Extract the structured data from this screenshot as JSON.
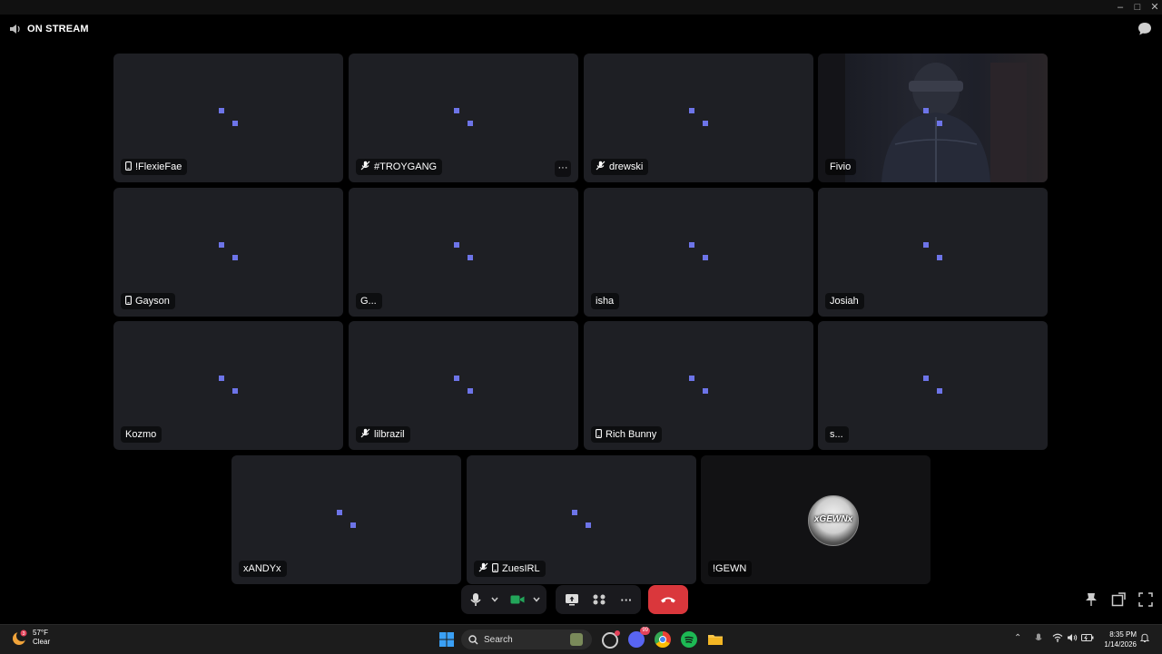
{
  "window": {
    "title": "",
    "controls": [
      "minimize-icon",
      "maximize-icon",
      "close-icon"
    ]
  },
  "stream_label": "ON STREAM",
  "colors": {
    "tile_bg": "#1e1f24",
    "accent": "#6d74e8",
    "end_call": "#da373c",
    "camera_on": "#23a55a"
  },
  "participants": [
    {
      "name": "!FlexieFae",
      "icon": "phone-icon"
    },
    {
      "name": "#TROYGANG",
      "icon": "mic-muted-icon",
      "menu": "···"
    },
    {
      "name": "drewski",
      "icon": "mic-muted-icon"
    },
    {
      "name": "Fivio",
      "video": true
    },
    {
      "name": "Gayson",
      "icon": "phone-icon"
    },
    {
      "name": "G..."
    },
    {
      "name": "isha"
    },
    {
      "name": "Josiah"
    },
    {
      "name": "Kozmo"
    },
    {
      "name": "lilbrazil",
      "icon": "mic-muted-icon"
    },
    {
      "name": "Rich Bunny",
      "icon": "phone-icon"
    },
    {
      "name": "s..."
    },
    {
      "name": "xANDYx"
    },
    {
      "name": "ZuesIRL",
      "icon": "mic-muted-icon",
      "icon2": "phone-icon"
    },
    {
      "name": "!GEWN",
      "avatar_text": "xGEWNx"
    }
  ],
  "controls": {
    "more_label": "···",
    "icons": [
      "microphone-icon",
      "chevron-down-icon",
      "camera-icon",
      "chevron-down-icon",
      "screen-share-icon",
      "activities-icon",
      "more-icon",
      "hang-up-icon"
    ]
  },
  "right_tools": [
    "pin-icon",
    "popout-icon",
    "fullscreen-icon"
  ],
  "taskbar": {
    "weather": {
      "temp": "57°F",
      "condition": "Clear",
      "badge": "3"
    },
    "search_placeholder": "Search",
    "discord_badge": "99",
    "time": "8:35 PM",
    "date": "1/14/2026"
  }
}
